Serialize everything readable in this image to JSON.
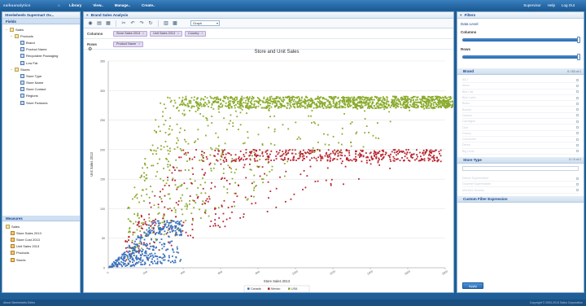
{
  "topbar": {
    "logo": "saikuanalytics",
    "nav": [
      "Library",
      "View..",
      "Manage..",
      "Create.."
    ],
    "user": [
      "Supervisor",
      "Help",
      "Log Out"
    ]
  },
  "left": {
    "title": "Steelwheels Supermart Ov...",
    "fields_label": "Fields",
    "tree": [
      {
        "label": "Sales",
        "level": 0,
        "kind": "fold",
        "toggle": "−"
      },
      {
        "label": "Products",
        "level": 1,
        "kind": "fold",
        "toggle": "−"
      },
      {
        "label": "Brand",
        "level": 2,
        "kind": "dim",
        "toggle": ""
      },
      {
        "label": "Product Name",
        "level": 2,
        "kind": "dim",
        "toggle": ""
      },
      {
        "label": "Recyclable Packaging",
        "level": 2,
        "kind": "dim",
        "toggle": ""
      },
      {
        "label": "Low Fat",
        "level": 2,
        "kind": "dim",
        "toggle": ""
      },
      {
        "label": "Stores",
        "level": 1,
        "kind": "fold",
        "toggle": "−"
      },
      {
        "label": "Store Type",
        "level": 2,
        "kind": "dim",
        "toggle": ""
      },
      {
        "label": "Store Name",
        "level": 2,
        "kind": "dim",
        "toggle": ""
      },
      {
        "label": "Store Contact",
        "level": 2,
        "kind": "dim",
        "toggle": ""
      },
      {
        "label": "Regions",
        "level": 2,
        "kind": "dim",
        "toggle": ""
      },
      {
        "label": "Store Features",
        "level": 2,
        "kind": "dim",
        "toggle": ""
      }
    ],
    "measures_label": "Measures",
    "measures": [
      {
        "label": "Sales",
        "level": 0,
        "kind": "fold"
      },
      {
        "label": "Store Sales 2013",
        "level": 1,
        "kind": "meas"
      },
      {
        "label": "Store Cost 2013",
        "level": 1,
        "kind": "meas"
      },
      {
        "label": "Unit Sales 2013",
        "level": 1,
        "kind": "meas"
      },
      {
        "label": "Products",
        "level": 1,
        "kind": "meas"
      },
      {
        "label": "Stores",
        "level": 1,
        "kind": "meas"
      }
    ]
  },
  "mid": {
    "title": "Brand Sales Analysis",
    "toolbar_icons": [
      "display-icon",
      "save-icon",
      "export-icon",
      "cut-icon",
      "undo-icon",
      "redo-icon",
      "refresh-icon",
      "filter-icon",
      "chart-icon"
    ],
    "chart_type_select": "Graph",
    "columns_label": "Columns",
    "columns": [
      "Store Sales 2013",
      "Unit Sales 2013",
      "Country"
    ],
    "rows_label": "Rows",
    "rows": [
      "Product Name"
    ]
  },
  "right": {
    "title": "Filters",
    "link": "Data Level",
    "columns_label": "Columns",
    "rows_label": "Rows",
    "brand_header": "Brand",
    "brand_count": "0 / 83 of 1",
    "brand_items": [
      "ADJ",
      "Akron",
      "Bird Call",
      "Blue Label",
      "Bravo",
      "Booker",
      "Carlson",
      "Carrington",
      "Club",
      "Colony",
      "Cormorant",
      "Denny",
      "Big Coral"
    ],
    "store_type_header": "Store Type",
    "store_type_count": "0 / 5 of 1",
    "store_type_items": [
      "Deluxe Supermarket",
      "Gourmet Supermarket",
      "Mid-Size Grocery"
    ],
    "custom_filter": "Custom Filter Expression",
    "apply_label": "Apply"
  },
  "footer": {
    "left": "About Steelwheels Editor",
    "right": "Copyright © 2000-2013 Saiku Corporation"
  },
  "chart_data": {
    "type": "scatter",
    "title": "Store and Unit Sales",
    "xlabel": "Store Sales 2013",
    "ylabel": "Unit Sales 2013",
    "ylim": [
      0,
      350
    ],
    "yticks": [
      0,
      50,
      100,
      150,
      200,
      250,
      300,
      350
    ],
    "xlim": [
      0,
      1800
    ],
    "xticks": [
      0,
      200,
      400,
      600,
      800,
      1000,
      1200,
      1400,
      1600,
      1800
    ],
    "grid": true,
    "legend_position": "bottom",
    "series": [
      {
        "name": "Canada",
        "color": "#3a6fba",
        "count": 420,
        "xmin": 5,
        "xmax": 395,
        "ymin_slope": 0.02,
        "ymax_slope": 0.34,
        "ycap": 80
      },
      {
        "name": "Mexico",
        "color": "#b8232e",
        "count": 650,
        "xmin": 80,
        "xmax": 1780,
        "ymin_slope": 0.11,
        "ymax_slope": 0.5,
        "ycap": 200
      },
      {
        "name": "USA",
        "color": "#8aab2c",
        "count": 1700,
        "xmin": 100,
        "xmax": 1850,
        "ymin_slope": 0.15,
        "ymax_slope": 1.0,
        "ycap": 290
      }
    ]
  }
}
